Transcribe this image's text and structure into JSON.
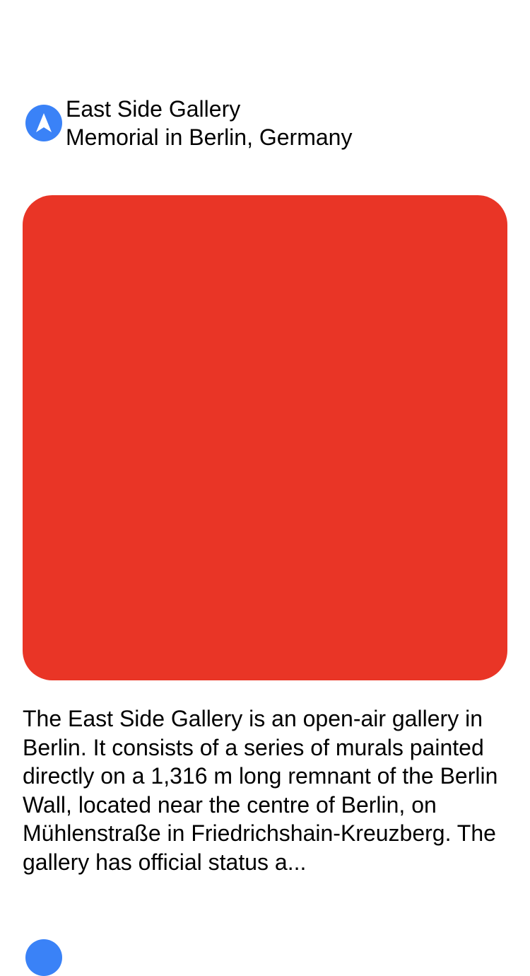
{
  "place": {
    "title": "East Side Gallery",
    "subtitle": "Memorial in Berlin, Germany",
    "icon": "navigation-arrow-icon",
    "icon_color": "#3a82f7",
    "photo_color": "#e93526",
    "description": "The East Side Gallery is an open-air gallery in Berlin. It consists of a series of murals painted directly on a 1,316 m long remnant of the Berlin Wall, located near the centre of Berlin, on Mühlenstraße in Friedrichshain-Kreuzberg. The gallery has official status a..."
  },
  "next_item": {
    "icon": "navigation-arrow-icon"
  }
}
